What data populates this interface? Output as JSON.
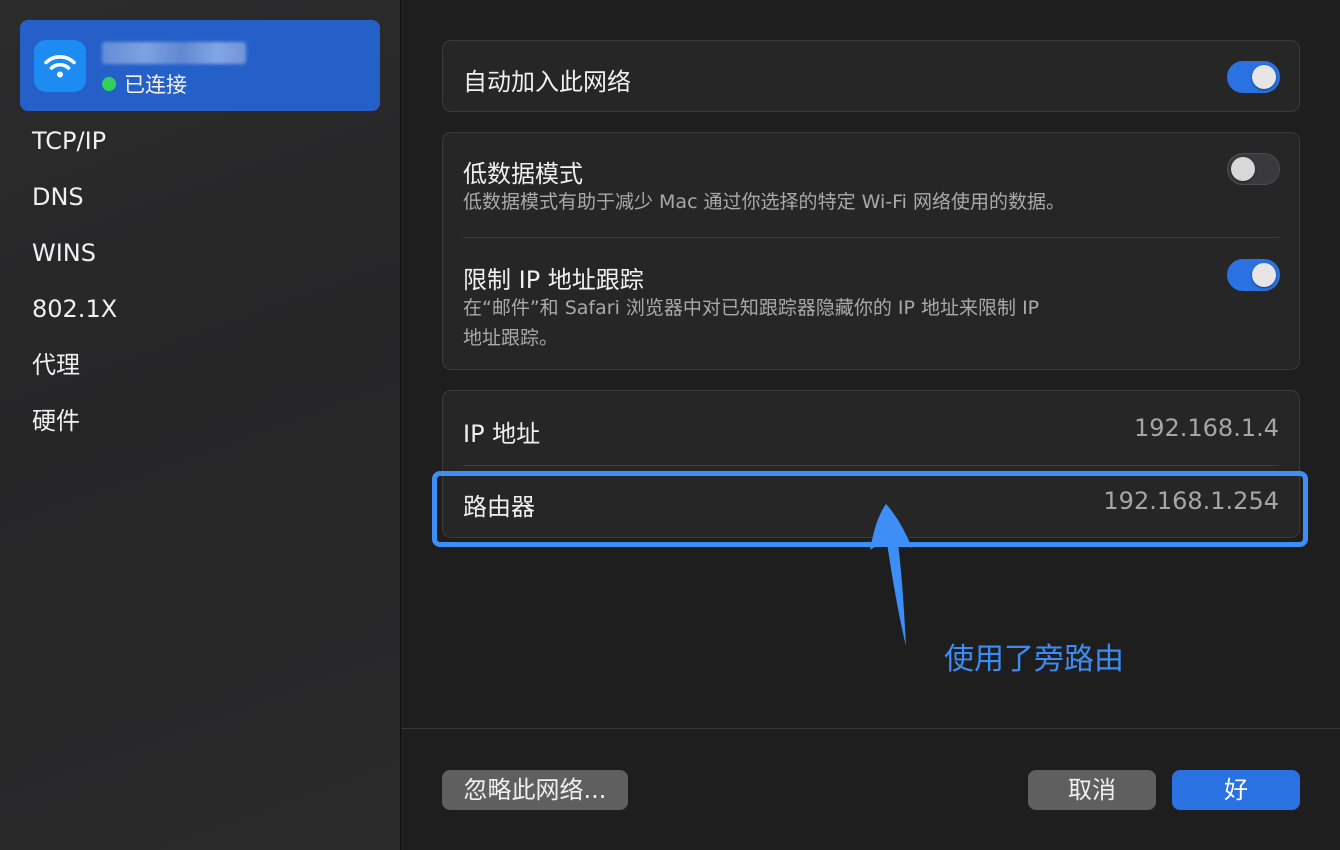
{
  "sidebar": {
    "network": {
      "status": "已连接",
      "icon": "wifi-icon",
      "status_color": "#2fd15a"
    },
    "items": [
      {
        "label": "TCP/IP"
      },
      {
        "label": "DNS"
      },
      {
        "label": "WINS"
      },
      {
        "label": "802.1X"
      },
      {
        "label": "代理"
      },
      {
        "label": "硬件"
      }
    ]
  },
  "settings": {
    "auto_join": {
      "label": "自动加入此网络",
      "enabled": true
    },
    "low_data": {
      "label": "低数据模式",
      "description": "低数据模式有助于减少 Mac 通过你选择的特定 Wi-Fi 网络使用的数据。",
      "enabled": false
    },
    "limit_ip": {
      "label": "限制 IP 地址跟踪",
      "description_line1": "在“邮件”和 Safari 浏览器中对已知跟踪器隐藏你的 IP 地址来限制 IP",
      "description_line2": "地址跟踪。",
      "enabled": true
    }
  },
  "network_info": {
    "ip_label": "IP 地址",
    "ip_value": "192.168.1.4",
    "router_label": "路由器",
    "router_value": "192.168.1.254"
  },
  "annotation": {
    "text": "使用了旁路由",
    "color": "#3b8df5"
  },
  "footer": {
    "forget_label": "忽略此网络...",
    "cancel_label": "取消",
    "ok_label": "好"
  },
  "colors": {
    "accent": "#2a72e2",
    "selection": "#2560c9",
    "annotation": "#3d8ef7"
  }
}
